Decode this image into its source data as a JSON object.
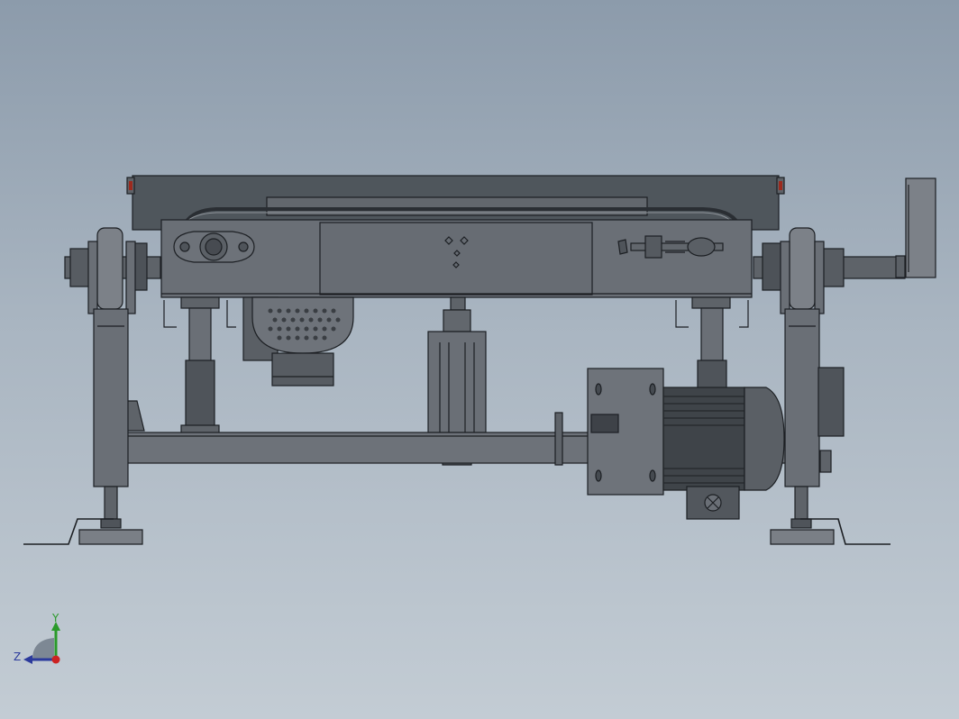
{
  "viewport": {
    "background_top": "#8c9bab",
    "background_bottom": "#c3ccd4"
  },
  "model": {
    "line_color": "#1c1f23",
    "body_color": "#676c73",
    "dark_color": "#4f545a",
    "light_color": "#8e9399",
    "accent_color": "#9c2a1e"
  },
  "triad": {
    "y_label": "Y",
    "z_label": "Z",
    "y_color": "#2a9a2a",
    "z_color": "#2b3a9c",
    "x_color": "#cc2222"
  }
}
